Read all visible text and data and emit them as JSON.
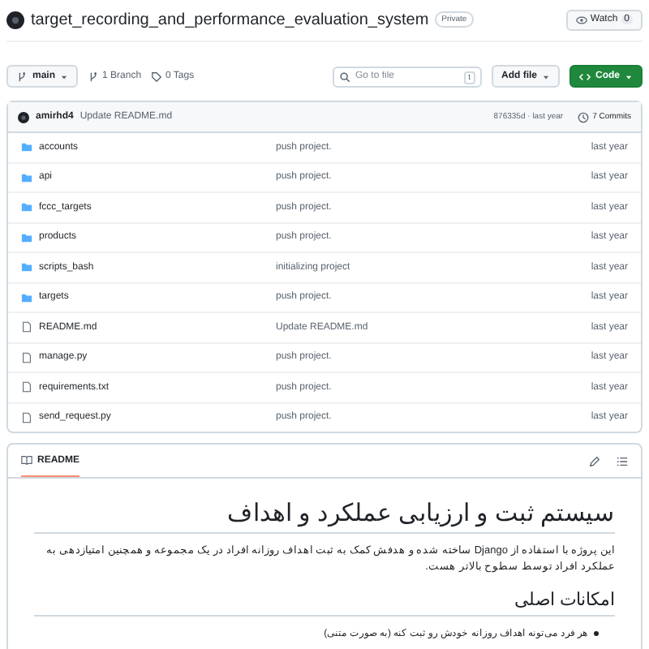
{
  "repo": {
    "name": "target_recording_and_performance_evaluation_system",
    "visibility": "Private",
    "watch": {
      "label": "Watch",
      "count": "0"
    }
  },
  "toolbar": {
    "branch": "main",
    "branches": "1 Branch",
    "tags": "0 Tags",
    "search": {
      "placeholder": "Go to file",
      "shortcut": "t"
    },
    "add_file": "Add file",
    "code": "Code"
  },
  "commit": {
    "author": "amirhd4",
    "message": "Update README.md",
    "hash": "876335d · last year",
    "commits": "7 Commits"
  },
  "files": [
    {
      "kind": "folder",
      "name": "accounts",
      "message": "push project.",
      "time": "last year"
    },
    {
      "kind": "folder",
      "name": "api",
      "message": "push project.",
      "time": "last year"
    },
    {
      "kind": "folder",
      "name": "fccc_targets",
      "message": "push project.",
      "time": "last year"
    },
    {
      "kind": "folder",
      "name": "products",
      "message": "push project.",
      "time": "last year"
    },
    {
      "kind": "folder",
      "name": "scripts_bash",
      "message": "initializing project",
      "time": "last year"
    },
    {
      "kind": "folder",
      "name": "targets",
      "message": "push project.",
      "time": "last year"
    },
    {
      "kind": "file",
      "name": "README.md",
      "message": "Update README.md",
      "time": "last year"
    },
    {
      "kind": "file",
      "name": "manage.py",
      "message": "push project.",
      "time": "last year"
    },
    {
      "kind": "file",
      "name": "requirements.txt",
      "message": "push project.",
      "time": "last year"
    },
    {
      "kind": "file",
      "name": "send_request.py",
      "message": "push project.",
      "time": "last year"
    }
  ],
  "readme": {
    "tab": "README",
    "title": "سیستم ثبت و ارزیابی عملکرد و اهداف",
    "intro": "این پروژه با استفاده از Django ساخته شده و هدفش کمک به ثبت اهداف روزانه افراد در یک مجموعه و همچنین امتیازدهی به عملکرد افراد توسط سطوح بالاتر هست.",
    "section": "امکانات اصلی",
    "bullets": [
      "هر فرد می‌تونه اهداف روزانه خودش رو ثبت کنه (به صورت متنی)"
    ]
  }
}
